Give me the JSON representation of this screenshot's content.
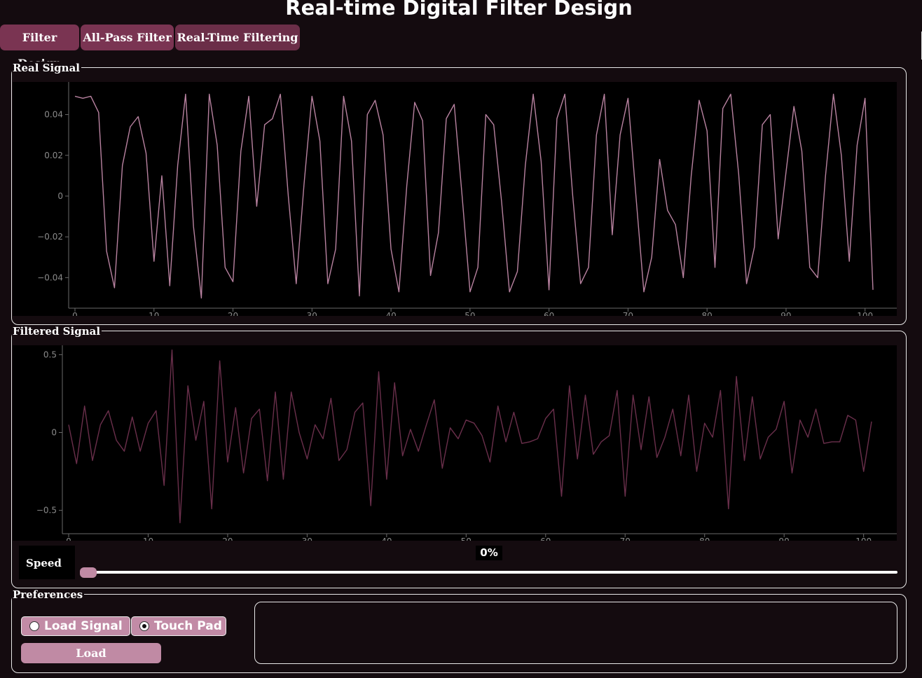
{
  "title": "Real-time Digital Filter Design",
  "tabs": [
    {
      "label": "Filter Design"
    },
    {
      "label": "All-Pass Filter"
    },
    {
      "label": "Real-Time Filtering"
    }
  ],
  "real_signal": {
    "group_title": "Real Signal"
  },
  "filtered_signal": {
    "group_title": "Filtered Signal"
  },
  "speed": {
    "label": "Speed",
    "percent_text": "0%",
    "value": 0
  },
  "preferences": {
    "group_title": "Preferences",
    "radio_load_label": "Load Signal",
    "radio_touch_label": "Touch Pad",
    "selected": "Touch Pad",
    "load_button_label": "Load"
  },
  "colors": {
    "background": "#140b0f",
    "accent": "#7a3452",
    "accent_light": "#c08aa4",
    "real_line": "#b882a0",
    "filtered_line": "#6a2f4b"
  },
  "chart_data": [
    {
      "type": "line",
      "xlim": [
        0,
        101
      ],
      "ylim": [
        -0.055,
        0.056
      ],
      "x_ticks": [
        0,
        10,
        20,
        30,
        40,
        50,
        60,
        70,
        80,
        90,
        100
      ],
      "x_tick_labels": [
        "0",
        "10",
        "20",
        "30",
        "40",
        "50",
        "60",
        "70",
        "80",
        "90",
        "100"
      ],
      "y_ticks": [
        -0.04,
        -0.02,
        0,
        0.02,
        0.04
      ],
      "y_tick_labels": [
        "−0.04",
        "−0.02",
        "0",
        "0.02",
        "0.04"
      ],
      "grid": false,
      "series": [
        {
          "x": [
            0,
            1,
            2,
            3,
            4,
            5,
            6,
            7,
            8,
            9,
            10,
            11,
            12,
            13,
            14,
            15,
            16,
            17,
            18,
            19,
            20,
            21,
            22,
            23,
            24,
            25,
            26,
            27,
            28,
            29,
            30,
            31,
            32,
            33,
            34,
            35,
            36,
            37,
            38,
            39,
            40,
            41,
            42,
            43,
            44,
            45,
            46,
            47,
            48,
            49,
            50,
            51,
            52,
            53,
            54,
            55,
            56,
            57,
            58,
            59,
            60,
            61,
            62,
            63,
            64,
            65,
            66,
            67,
            68,
            69,
            70,
            71,
            72,
            73,
            74,
            75,
            76,
            77,
            78,
            79,
            80,
            81,
            82,
            83,
            84,
            85,
            86,
            87,
            88,
            89,
            90,
            91,
            92,
            93,
            94,
            95,
            96,
            97,
            98,
            99,
            100,
            101
          ],
          "y": [
            0.049,
            0.048,
            0.049,
            0.041,
            -0.027,
            -0.045,
            0.015,
            0.034,
            0.039,
            0.021,
            -0.032,
            0.01,
            -0.044,
            0.015,
            0.05,
            -0.015,
            -0.05,
            0.05,
            0.025,
            -0.035,
            -0.042,
            0.022,
            0.049,
            -0.005,
            0.035,
            0.038,
            0.05,
            0.0,
            -0.043,
            0.006,
            0.049,
            0.027,
            -0.043,
            -0.026,
            0.049,
            0.027,
            -0.049,
            0.04,
            0.047,
            0.03,
            -0.026,
            -0.047,
            0.005,
            0.046,
            0.037,
            -0.039,
            -0.018,
            0.038,
            0.045,
            0.0,
            -0.047,
            -0.035,
            0.04,
            0.035,
            -0.003,
            -0.047,
            -0.037,
            0.015,
            0.05,
            0.017,
            -0.046,
            0.038,
            0.05,
            0.0,
            -0.043,
            -0.035,
            0.03,
            0.05,
            -0.019,
            0.03,
            0.048,
            0.0,
            -0.047,
            -0.03,
            0.018,
            -0.007,
            -0.014,
            -0.04,
            0.01,
            0.047,
            0.032,
            -0.035,
            0.043,
            0.05,
            0.011,
            -0.043,
            -0.025,
            0.035,
            0.04,
            -0.021,
            0.012,
            0.044,
            0.022,
            -0.035,
            -0.04,
            0.01,
            0.05,
            0.02,
            -0.032,
            0.025,
            0.048,
            -0.046
          ]
        }
      ]
    },
    {
      "type": "line",
      "xlim": [
        0,
        101
      ],
      "ylim": [
        -0.65,
        0.56
      ],
      "x_ticks": [
        0,
        10,
        20,
        30,
        40,
        50,
        60,
        70,
        80,
        90,
        100
      ],
      "x_tick_labels": [
        "0",
        "10",
        "20",
        "30",
        "40",
        "50",
        "60",
        "70",
        "80",
        "90",
        "100"
      ],
      "y_ticks": [
        -0.5,
        0,
        0.5
      ],
      "y_tick_labels": [
        "−0.5",
        "0",
        "0.5"
      ],
      "grid": false,
      "series": [
        {
          "x": [
            0,
            1,
            2,
            3,
            4,
            5,
            6,
            7,
            8,
            9,
            10,
            11,
            12,
            13,
            14,
            15,
            16,
            17,
            18,
            19,
            20,
            21,
            22,
            23,
            24,
            25,
            26,
            27,
            28,
            29,
            30,
            31,
            32,
            33,
            34,
            35,
            36,
            37,
            38,
            39,
            40,
            41,
            42,
            43,
            44,
            45,
            46,
            47,
            48,
            49,
            50,
            51,
            52,
            53,
            54,
            55,
            56,
            57,
            58,
            59,
            60,
            61,
            62,
            63,
            64,
            65,
            66,
            67,
            68,
            69,
            70,
            71,
            72,
            73,
            74,
            75,
            76,
            77,
            78,
            79,
            80,
            81,
            82,
            83,
            84,
            85,
            86,
            87,
            88,
            89,
            90,
            91,
            92,
            93,
            94,
            95,
            96,
            97,
            98,
            99,
            100,
            101
          ],
          "y": [
            0.05,
            -0.2,
            0.17,
            -0.18,
            0.05,
            0.14,
            -0.05,
            -0.12,
            0.1,
            -0.12,
            0.06,
            0.14,
            -0.34,
            0.53,
            -0.58,
            0.3,
            -0.05,
            0.2,
            -0.49,
            0.46,
            -0.19,
            0.16,
            -0.26,
            0.09,
            0.15,
            -0.31,
            0.26,
            -0.3,
            0.26,
            0.0,
            -0.17,
            0.05,
            -0.04,
            0.22,
            -0.18,
            -0.11,
            0.13,
            0.19,
            -0.47,
            0.39,
            -0.3,
            0.32,
            -0.15,
            0.02,
            -0.12,
            0.05,
            0.21,
            -0.23,
            0.03,
            -0.04,
            0.08,
            0.06,
            -0.02,
            -0.19,
            0.17,
            -0.06,
            0.13,
            -0.07,
            -0.06,
            -0.04,
            0.09,
            0.15,
            -0.41,
            0.3,
            -0.17,
            0.24,
            -0.14,
            -0.06,
            -0.02,
            0.27,
            -0.41,
            0.24,
            -0.11,
            0.23,
            -0.16,
            -0.03,
            0.15,
            -0.15,
            0.24,
            -0.25,
            0.06,
            -0.03,
            0.27,
            -0.49,
            0.36,
            -0.18,
            0.23,
            -0.17,
            -0.03,
            0.02,
            0.2,
            -0.26,
            0.08,
            -0.03,
            0.15,
            -0.07,
            -0.06,
            -0.06,
            0.11,
            0.08,
            -0.25,
            0.07
          ]
        }
      ]
    }
  ]
}
